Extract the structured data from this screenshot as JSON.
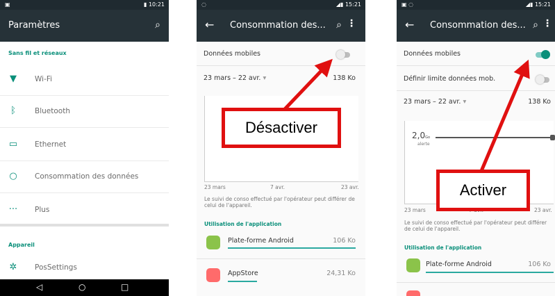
{
  "screen1": {
    "status_time": "10:21",
    "title": "Paramètres",
    "section_network": "Sans fil et réseaux",
    "items": [
      {
        "label": "Wi-Fi",
        "icon": "wifi-icon"
      },
      {
        "label": "Bluetooth",
        "icon": "bluetooth-icon"
      },
      {
        "label": "Ethernet",
        "icon": "monitor-icon"
      },
      {
        "label": "Consommation des données",
        "icon": "data-usage-icon"
      },
      {
        "label": "Plus",
        "icon": "more-horizontal-icon"
      }
    ],
    "section_device": "Appareil",
    "item_possettings": "PosSettings"
  },
  "screen2": {
    "status_time": "15:21",
    "title": "Consommation des...",
    "mobile_data": "Données mobiles",
    "mobile_data_enabled": false,
    "period": "23 mars – 22 avr.",
    "usage": "138 Ko",
    "chart_axis": [
      "23 mars",
      "7 avr.",
      "23 avr."
    ],
    "note": "Le suivi de conso effectué par l'opérateur peut différer de celui de l'appareil.",
    "app_usage_header": "Utilisation de l'application",
    "apps": [
      {
        "name": "Plate-forme Android",
        "usage": "106 Ko",
        "share": 1.0
      },
      {
        "name": "AppStore",
        "usage": "24,31 Ko",
        "share": 0.23
      }
    ],
    "callout": "Désactiver"
  },
  "screen3": {
    "status_time": "15:21",
    "title": "Consommation des...",
    "mobile_data": "Données mobiles",
    "mobile_data_enabled": true,
    "limit_label": "Définir limite données mob.",
    "limit_enabled": false,
    "period": "23 mars – 22 avr.",
    "usage": "138 Ko",
    "warning_value": "2,0",
    "warning_unit": "Go",
    "warning_label": "alerte",
    "chart_axis": [
      "23 mars",
      "7 avr.",
      "23 avr."
    ],
    "note": "Le suivi de conso effectué par l'opérateur peut différer de celui de l'appareil.",
    "app_usage_header": "Utilisation de l'application",
    "apps": [
      {
        "name": "Plate-forme Android",
        "usage": "106 Ko",
        "share": 1.0
      }
    ],
    "callout": "Activer"
  },
  "colors": {
    "accent": "#0a8f7a",
    "appbar": "#263238",
    "arrow": "#e01010"
  }
}
